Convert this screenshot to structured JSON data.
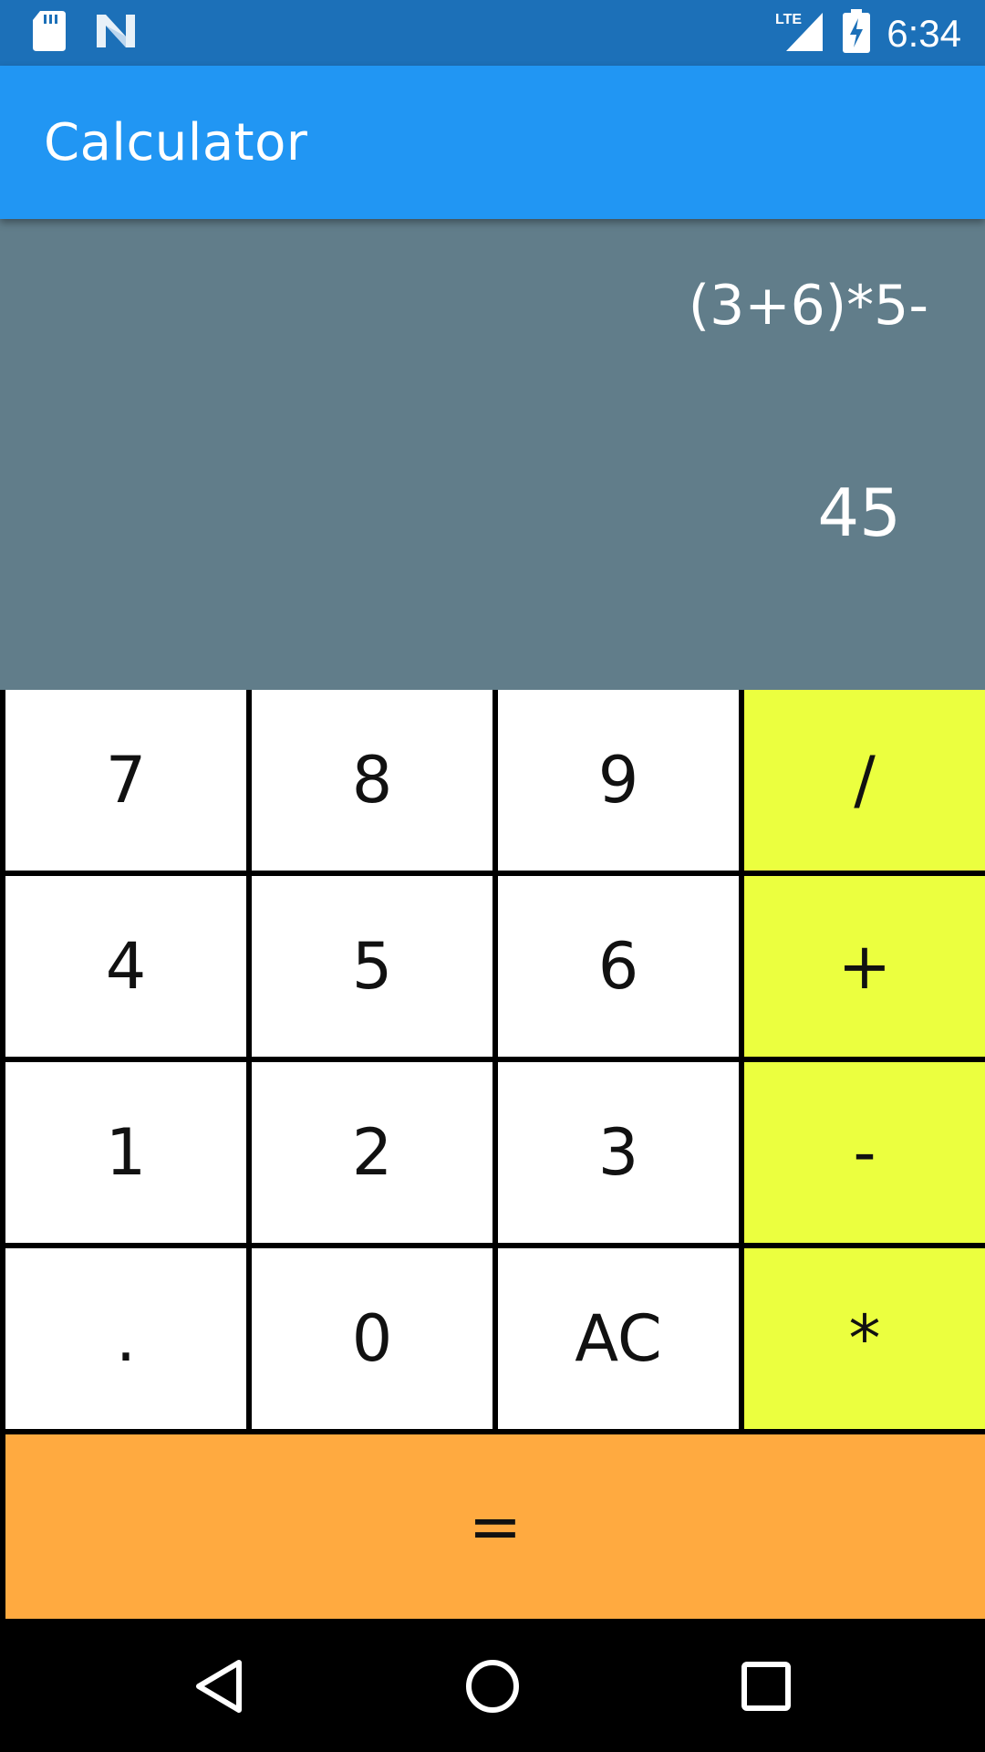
{
  "status_bar": {
    "time": "6:34",
    "network": "LTE",
    "icons": [
      "sd-card-icon",
      "n-logo-icon",
      "signal-icon",
      "battery-charging-icon"
    ]
  },
  "app_bar": {
    "title": "Calculator"
  },
  "display": {
    "expression": "(3+6)*5-",
    "result": "45"
  },
  "keypad": {
    "rows": [
      [
        "7",
        "8",
        "9",
        "/"
      ],
      [
        "4",
        "5",
        "6",
        "+"
      ],
      [
        "1",
        "2",
        "3",
        "-"
      ],
      [
        ".",
        "0",
        "AC",
        "*"
      ]
    ],
    "equals": "="
  },
  "colors": {
    "status_bar": "#1c70b8",
    "app_bar": "#2196f3",
    "display": "#617d8a",
    "number_key": "#ffffff",
    "operator_key": "#ebff3f",
    "equals_key": "#ffaa40"
  },
  "nav_bar": {
    "icons": [
      "back-icon",
      "home-icon",
      "recents-icon"
    ]
  }
}
